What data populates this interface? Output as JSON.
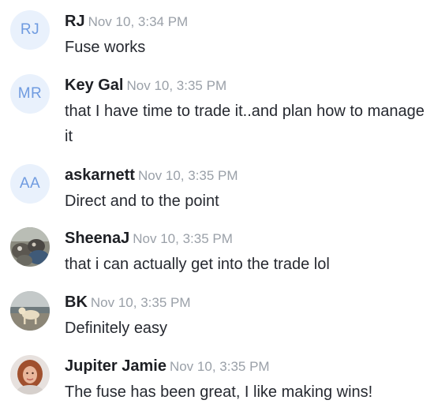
{
  "messages": [
    {
      "author": "RJ",
      "initials": "RJ",
      "time": "Nov 10, 3:34 PM",
      "text": "Fuse works",
      "avatar_icon": "initials-avatar"
    },
    {
      "author": "Key Gal",
      "initials": "MR",
      "time": "Nov 10, 3:35 PM",
      "text": "that I have time to trade it..and plan how to manage it",
      "avatar_icon": "initials-avatar"
    },
    {
      "author": "askarnett",
      "initials": "AA",
      "time": "Nov 10, 3:35 PM",
      "text": "Direct and to the point",
      "avatar_icon": "initials-avatar"
    },
    {
      "author": "SheenaJ",
      "time": "Nov 10, 3:35 PM",
      "text": "that i can actually get into the trade lol",
      "avatar_icon": "photo-avatar-dogs"
    },
    {
      "author": "BK",
      "time": "Nov 10, 3:35 PM",
      "text": "Definitely easy",
      "avatar_icon": "photo-avatar-dog-beach"
    },
    {
      "author": "Jupiter Jamie",
      "time": "Nov 10, 3:35 PM",
      "text": "The fuse has been great, I like making wins!",
      "avatar_icon": "photo-avatar-woman"
    }
  ],
  "colors": {
    "initials_bg": "#e9f1fc",
    "initials_text": "#6f9be0",
    "name": "#1d1f24",
    "timestamp": "#9aa0a8",
    "message_text": "#262930"
  }
}
